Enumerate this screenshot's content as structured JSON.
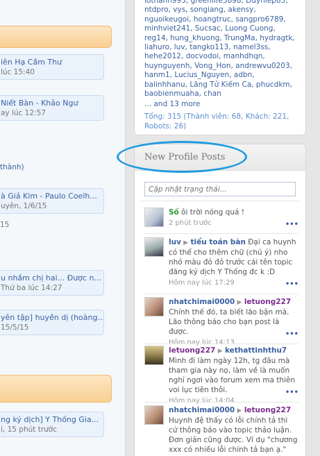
{
  "left": {
    "cards": [
      {
        "title": "iên Hạ Cầm Thư",
        "sub": "lúc 15:40"
      },
      {
        "title": "Niết Bàn - Khảo Ngư",
        "sub": "ay lúc 12:57"
      },
      {
        "title": "à Giả Kim - Paulo Coelh...",
        "sub": "uyên, 1/6/15"
      },
      {
        "title": "u nhầm chị hai... Được n...",
        "sub": "Thứ ba lúc 14:27"
      },
      {
        "title": "yên tập] huyền dị (hoàng...",
        "sub": "15/5/15"
      },
      {
        "title": "ng ký dịch] Y Thống Gia...",
        "sub": "i, 15 phút trước"
      }
    ],
    "loose": {
      "a": "thành)",
      "b": "15"
    }
  },
  "online": {
    "names_text": "lothann993, greenlife5898, Duyhiep83, ntdpro, vys, songiang, akensy, nguoikeugoi, hoangtruc, sangpro6789, minhviet241, Sucsac, Luong Cuong, reg14, hung_khuong, TrungMa, hydragtk, liahuro, luv, tangko113, namel3ss, hehe2012, docvodoi, manhdhqn, huynguyenh, Vong_Hon, andrewvu0203, hanm1, Lucius_Nguyen, adbn, balinhhanu, Lãng Tử Kiếm Ca, phucdkm, baobienmuaha, chan",
    "more": "... and 13 more",
    "stats": "Tổng: 315 (Thành viên: 68, Khách: 221, Robots: 26)"
  },
  "profile_posts": {
    "title": "New Profile Posts",
    "input_placeholder": "Cập nhật trạng thái...",
    "posts": [
      {
        "user": "Số",
        "target": "",
        "text": "ôi trời nóng quá !",
        "time": "2 phút trước",
        "user_color": "#2a9b2a"
      },
      {
        "user": "luv",
        "target": "tiểu toán bàn",
        "text": "Đại ca huynh có thể cho thêm chữ (chú ý) nho nhỏ màu đỏ đỏ trước cái tên topic đăng ký dịch Y Thống đc k :D",
        "time": "Hôm nay lúc 17:29",
        "user_color": "#3b61a0"
      },
      {
        "user": "nhatchimai0000",
        "target": "letuong227",
        "text": "Chính thế đó, ta biết lão bận mà. Lão thông báo cho bạn post là được.",
        "time": "Hôm nay lúc 14:13",
        "user_color": "#3b61a0"
      },
      {
        "user": "letuong227",
        "target": "kethattinhthu7",
        "text": "Mình đi làm ngày 12h, tg đâu mà tham gia này nọ, làm về là muốn nghỉ ngơi vào forum xem ma thiên voi lục tiên thôi.",
        "time": "Hôm nay lúc 14:04",
        "user_color": "#3b61a0"
      },
      {
        "user": "nhatchimai0000",
        "target": "letuong227",
        "text": "Huynh đệ thấy có lỗi chính tả thì cứ thông báo vào topic thảo luận. Đơn giản cũng được. Ví dụ \"chương xxx có nhiều lỗi chính tả bạn ạ.\"",
        "time": "",
        "user_color": "#3b61a0"
      }
    ],
    "more_label": "•••"
  },
  "colors": {
    "link": "#3b61a0",
    "annotation": "#1e9be0",
    "orange": "#f9cf92",
    "target_purple": "#7b2d8e"
  }
}
